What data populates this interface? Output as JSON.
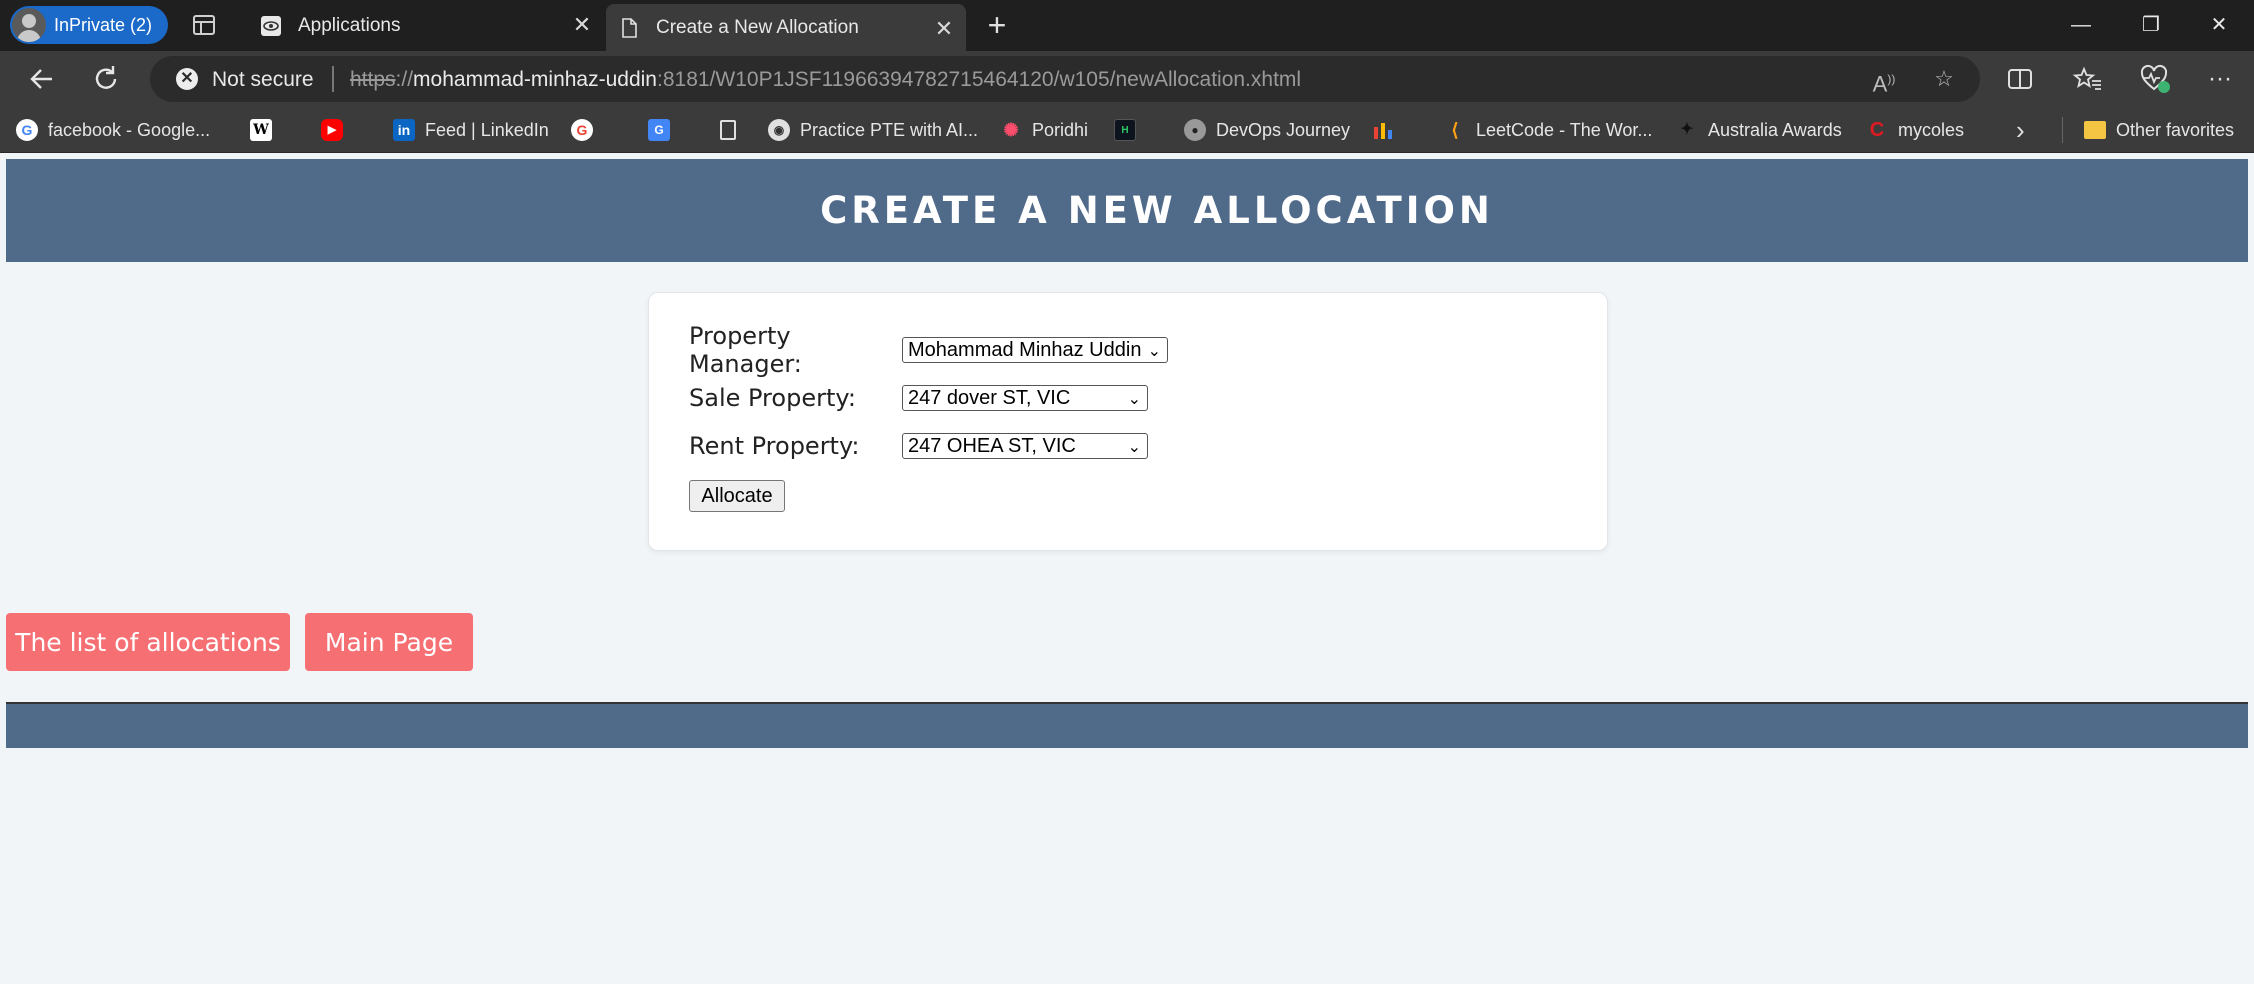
{
  "browser": {
    "inprivate_label": "InPrivate (2)",
    "tabs": [
      {
        "title": "Applications",
        "close": "✕"
      },
      {
        "title": "Create a New Allocation",
        "close": "✕"
      }
    ],
    "new_tab": "+",
    "window": {
      "minimize": "—",
      "maximize": "❐",
      "close": "✕"
    },
    "security_label": "Not secure",
    "url": {
      "scheme": "https",
      "sep": "://",
      "host": "mohammad-minhaz-uddin",
      "rest": ":8181/W10P1JSF11966394782715464120/w105/newAllocation.xhtml"
    },
    "bookmarks": [
      {
        "label": "facebook - Google...",
        "icon": "google-icon"
      },
      {
        "label": "",
        "icon": "wikipedia-icon"
      },
      {
        "label": "",
        "icon": "youtube-icon"
      },
      {
        "label": "Feed | LinkedIn",
        "icon": "linkedin-icon"
      },
      {
        "label": "",
        "icon": "google-icon"
      },
      {
        "label": "",
        "icon": "translate-icon"
      },
      {
        "label": "",
        "icon": "page-icon"
      },
      {
        "label": "Practice PTE with AI...",
        "icon": "pte-icon"
      },
      {
        "label": "Poridhi",
        "icon": "poridhi-icon"
      },
      {
        "label": "",
        "icon": "hackerrank-icon"
      },
      {
        "label": "DevOps Journey",
        "icon": "devops-icon"
      },
      {
        "label": "",
        "icon": "chart-icon"
      },
      {
        "label": "LeetCode - The Wor...",
        "icon": "leetcode-icon"
      },
      {
        "label": "Australia Awards",
        "icon": "australia-awards-icon"
      },
      {
        "label": "mycoles",
        "icon": "coles-icon"
      }
    ],
    "other_favorites": "Other favorites"
  },
  "page": {
    "title": "CREATE A NEW ALLOCATION",
    "form": {
      "property_manager_label": "Property Manager:",
      "property_manager_value": "Mohammad Minhaz Uddin",
      "sale_property_label": "Sale Property:",
      "sale_property_value": "247 dover ST, VIC",
      "rent_property_label": "Rent Property:",
      "rent_property_value": "247 OHEA ST, VIC",
      "allocate_label": "Allocate"
    },
    "buttons": {
      "list_label": "The list of allocations",
      "main_label": "Main Page"
    }
  },
  "colors": {
    "header": "#506a8a",
    "button": "#f56f73",
    "background": "#f2f5f8"
  }
}
